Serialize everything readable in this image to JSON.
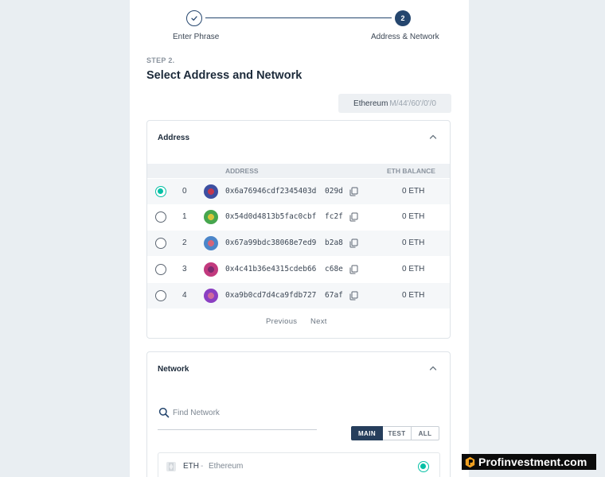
{
  "stepper": {
    "steps": [
      {
        "label": "Enter Phrase",
        "number": "",
        "state": "done"
      },
      {
        "label": "Address & Network",
        "number": "2",
        "state": "active"
      }
    ]
  },
  "header": {
    "step_kicker": "STEP 2.",
    "title": "Select Address and Network"
  },
  "derivation": {
    "network": "Ethereum",
    "path": "M/44'/60'/0'/0"
  },
  "address_panel": {
    "title": "Address",
    "columns": {
      "address": "ADDRESS",
      "balance": "ETH BALANCE"
    },
    "rows": [
      {
        "index": "0",
        "address": "0x6a76946cdf2345403d",
        "ending": "029d",
        "balance": "0 ETH",
        "selected": true,
        "avatar_colors": [
          "#3d4fa1",
          "#c2384e"
        ]
      },
      {
        "index": "1",
        "address": "0x54d0d4813b5fac0cbf",
        "ending": "fc2f",
        "balance": "0 ETH",
        "selected": false,
        "avatar_colors": [
          "#46a64e",
          "#d8c43a"
        ]
      },
      {
        "index": "2",
        "address": "0x67a99bdc38068e7ed9",
        "ending": "b2a8",
        "balance": "0 ETH",
        "selected": false,
        "avatar_colors": [
          "#4c86c9",
          "#d4657a"
        ]
      },
      {
        "index": "3",
        "address": "0x4c41b36e4315cdeb66",
        "ending": "c68e",
        "balance": "0 ETH",
        "selected": false,
        "avatar_colors": [
          "#c23a7e",
          "#7c2a6e"
        ]
      },
      {
        "index": "4",
        "address": "0xa9b0cd7d4ca9fdb727",
        "ending": "67af",
        "balance": "0 ETH",
        "selected": false,
        "avatar_colors": [
          "#8b3fc2",
          "#d06a9c"
        ]
      }
    ],
    "pagination": {
      "previous": "Previous",
      "next": "Next"
    }
  },
  "network_panel": {
    "title": "Network",
    "search_placeholder": "Find Network",
    "filters": {
      "main": "MAIN",
      "test": "TEST",
      "all": "ALL",
      "active": "MAIN"
    },
    "networks": [
      {
        "symbol": "ETH",
        "separator": "-",
        "name": "Ethereum",
        "selected": true
      }
    ]
  },
  "watermark": {
    "text": "Profinvestment.com"
  },
  "colors": {
    "accent": "#05c0a5",
    "primary": "#25466e",
    "panel_border": "#dfe4e9"
  }
}
